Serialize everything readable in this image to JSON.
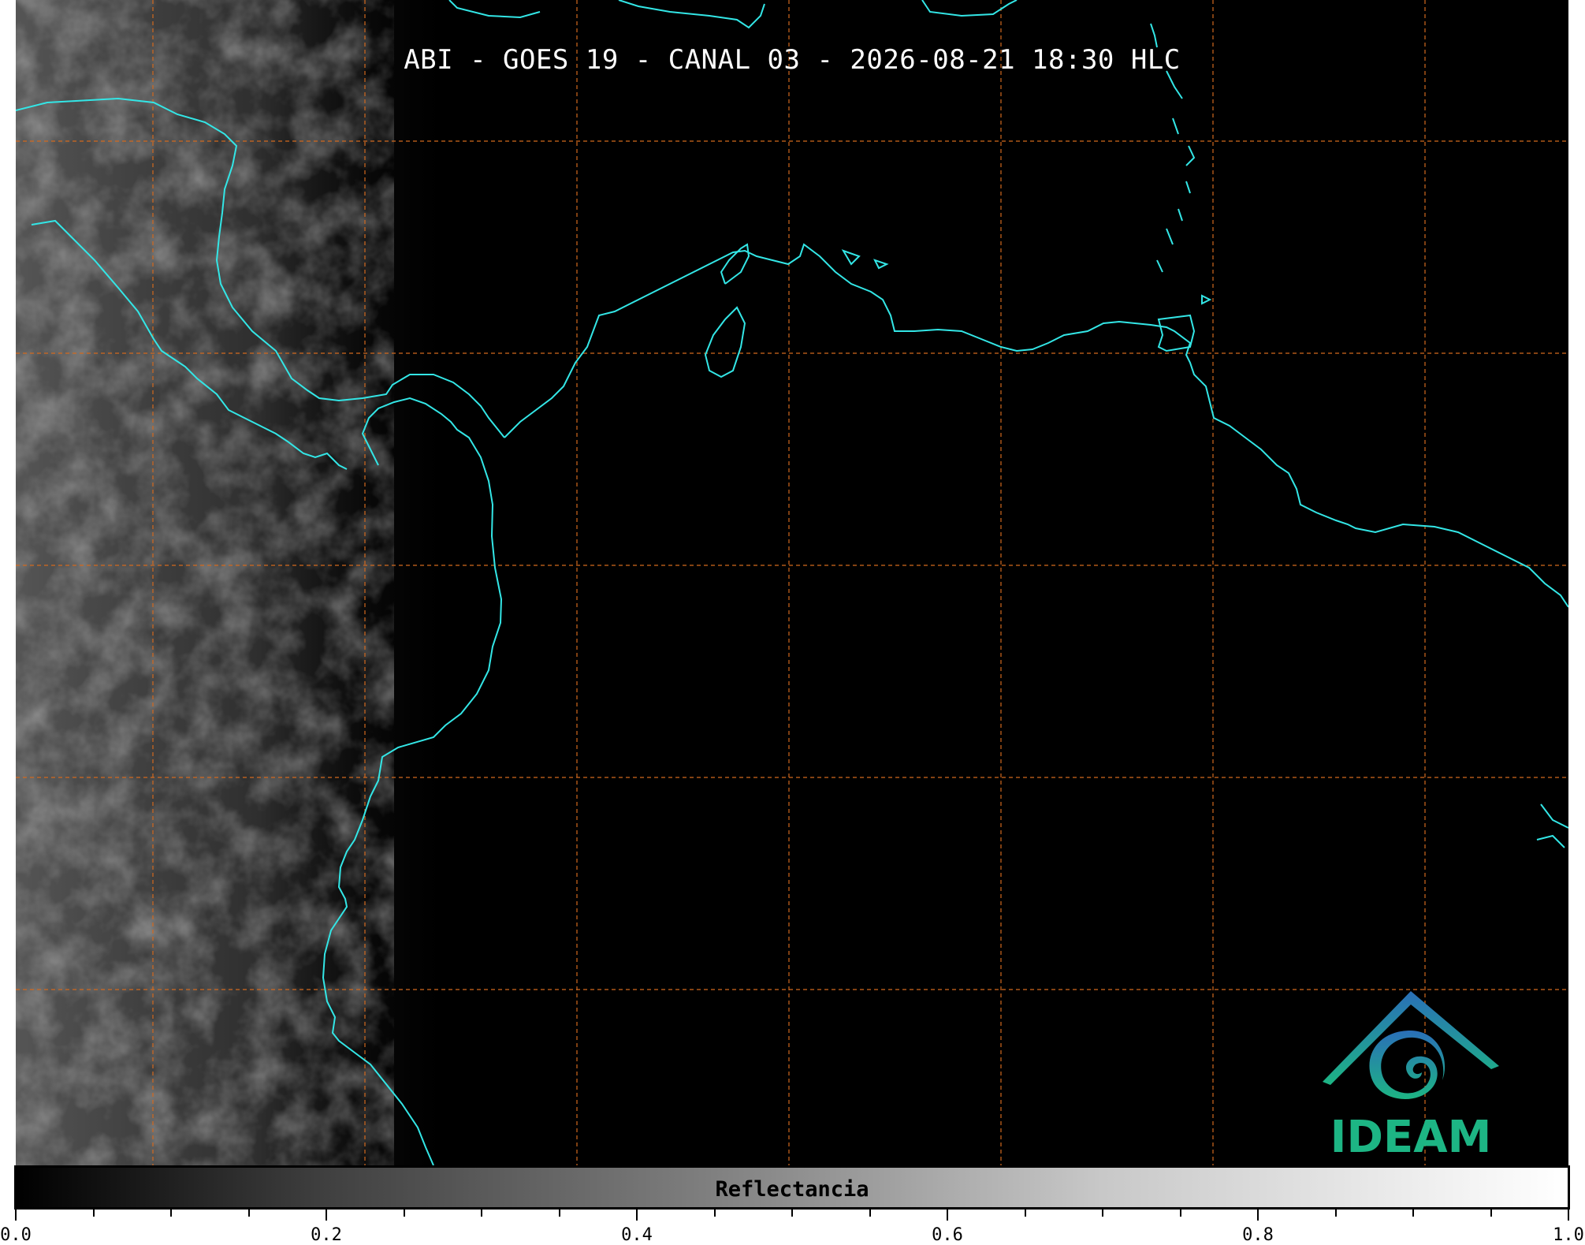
{
  "title": "ABI - GOES 19 - CANAL 03 - 2026-08-21 18:30 HLC",
  "colorbar": {
    "label": "Reflectancia",
    "range": [
      0.0,
      1.0
    ],
    "ticks": [
      "0.0",
      "0.2",
      "0.4",
      "0.6",
      "0.8",
      "1.0"
    ]
  },
  "logo": {
    "text": "IDEAM"
  },
  "colors": {
    "coastline": "#33e6e6",
    "gridlines": "#d2691e",
    "background": "#000000",
    "logo_blue": "#2a7fb8",
    "logo_green": "#1db584"
  }
}
